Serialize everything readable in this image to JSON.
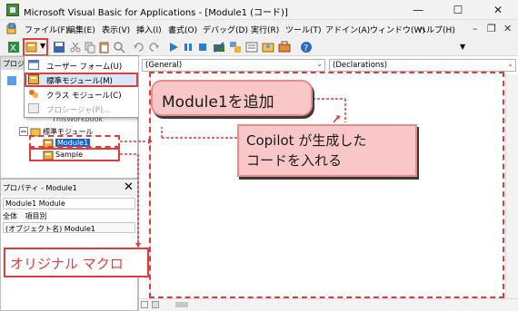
{
  "window": {
    "title": "Microsoft Visual Basic for Applications - [Module1 (コード)]",
    "minimize": "—",
    "maximize": "☐",
    "close": "✕"
  },
  "menu": {
    "items": [
      "ファイル(F)",
      "編集(E)",
      "表示(V)",
      "挿入(I)",
      "書式(O)",
      "デバッグ(D)",
      "実行(R)",
      "ツール(T)",
      "アドイン(A)",
      "ウィンドウ(W)",
      "ヘルプ(H)"
    ],
    "mdi_minimize": "–",
    "mdi_restore": "❐",
    "mdi_close": "✕"
  },
  "insert_menu": {
    "items": [
      {
        "label": "ユーザー フォーム(U)",
        "icon": "userform-icon",
        "disabled": false
      },
      {
        "label": "標準モジュール(M)",
        "icon": "module-icon",
        "disabled": false,
        "highlighted": true
      },
      {
        "label": "クラス モジュール(C)",
        "icon": "class-module-icon",
        "disabled": false
      },
      {
        "label": "プロシージャ(P)...",
        "icon": "procedure-icon",
        "disabled": true
      }
    ]
  },
  "project": {
    "header": "プロジェクト",
    "workbook_item": "ThisWorkbook",
    "modules_folder": "標準モジュール",
    "module1": "Module1",
    "sample": "Sample"
  },
  "properties": {
    "header": "プロパティ - Module1",
    "close": "✕",
    "object": "Module1 Module",
    "tabs": [
      "全体",
      "項目別"
    ],
    "name_row": "(オブジェクト名)  Module1"
  },
  "code": {
    "object_combo": "(General)",
    "proc_combo": "(Declarations)"
  },
  "annotations": {
    "add_module": "Module1を追加",
    "copilot": [
      "Copilot が生成した",
      "コードを入れる"
    ],
    "original": "オリジナル マクロ"
  },
  "colors": {
    "accent_red": "#e23b3b",
    "callout_fill": "#f9c7c7",
    "highlight": "#d6e8fb"
  }
}
